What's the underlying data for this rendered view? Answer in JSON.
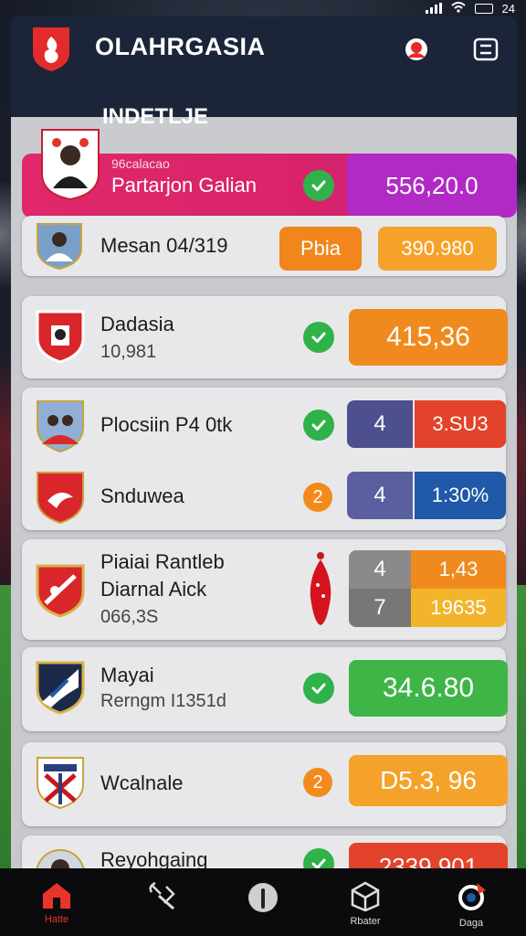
{
  "status_bar": {
    "time": "24"
  },
  "app": {
    "title": "OLAHRGASIA"
  },
  "section": {
    "title": "INDETLJE"
  },
  "featured": {
    "subtitle": "96calacao",
    "name": "Partarjon Galian",
    "value": "556,20.0"
  },
  "rows": [
    {
      "name": "Mesan 04/319",
      "tag": "Pbia",
      "value": "390.980"
    },
    {
      "name": "Dadasia",
      "sub": "10,981",
      "value": "415,36"
    },
    {
      "name": "Plocsiin P4 0tk",
      "left": "4",
      "right": "3.SU3"
    },
    {
      "name": "Snduwea",
      "num": "2",
      "left": "4",
      "right": "1:30%"
    },
    {
      "name1": "Piaiai Rantleb",
      "name2": "Diarnal Aick",
      "sub": "066,3S",
      "top_left": "4",
      "top_right": "1,43",
      "bottom_left": "7",
      "bottom_right": "19635"
    },
    {
      "name": "Mayai",
      "sub": "Rerngm I1351d",
      "value": "34.6.80"
    },
    {
      "name": "Wcalnale",
      "num": "2",
      "value": "D5.3, 96"
    },
    {
      "name": "Reyohgaing",
      "value": "2339.901"
    }
  ],
  "nav": {
    "home": "Hatte",
    "second": "",
    "third": "",
    "fourth": "Rbater",
    "fifth": "Daga"
  },
  "colors": {
    "header": "#1b2438",
    "featured": "#e0286a",
    "orange": "#f28a1c",
    "green": "#3fb548",
    "red": "#e3432a",
    "blue": "#2059a8",
    "slate": "#5a5fa0",
    "active_nav": "#e8342a"
  }
}
